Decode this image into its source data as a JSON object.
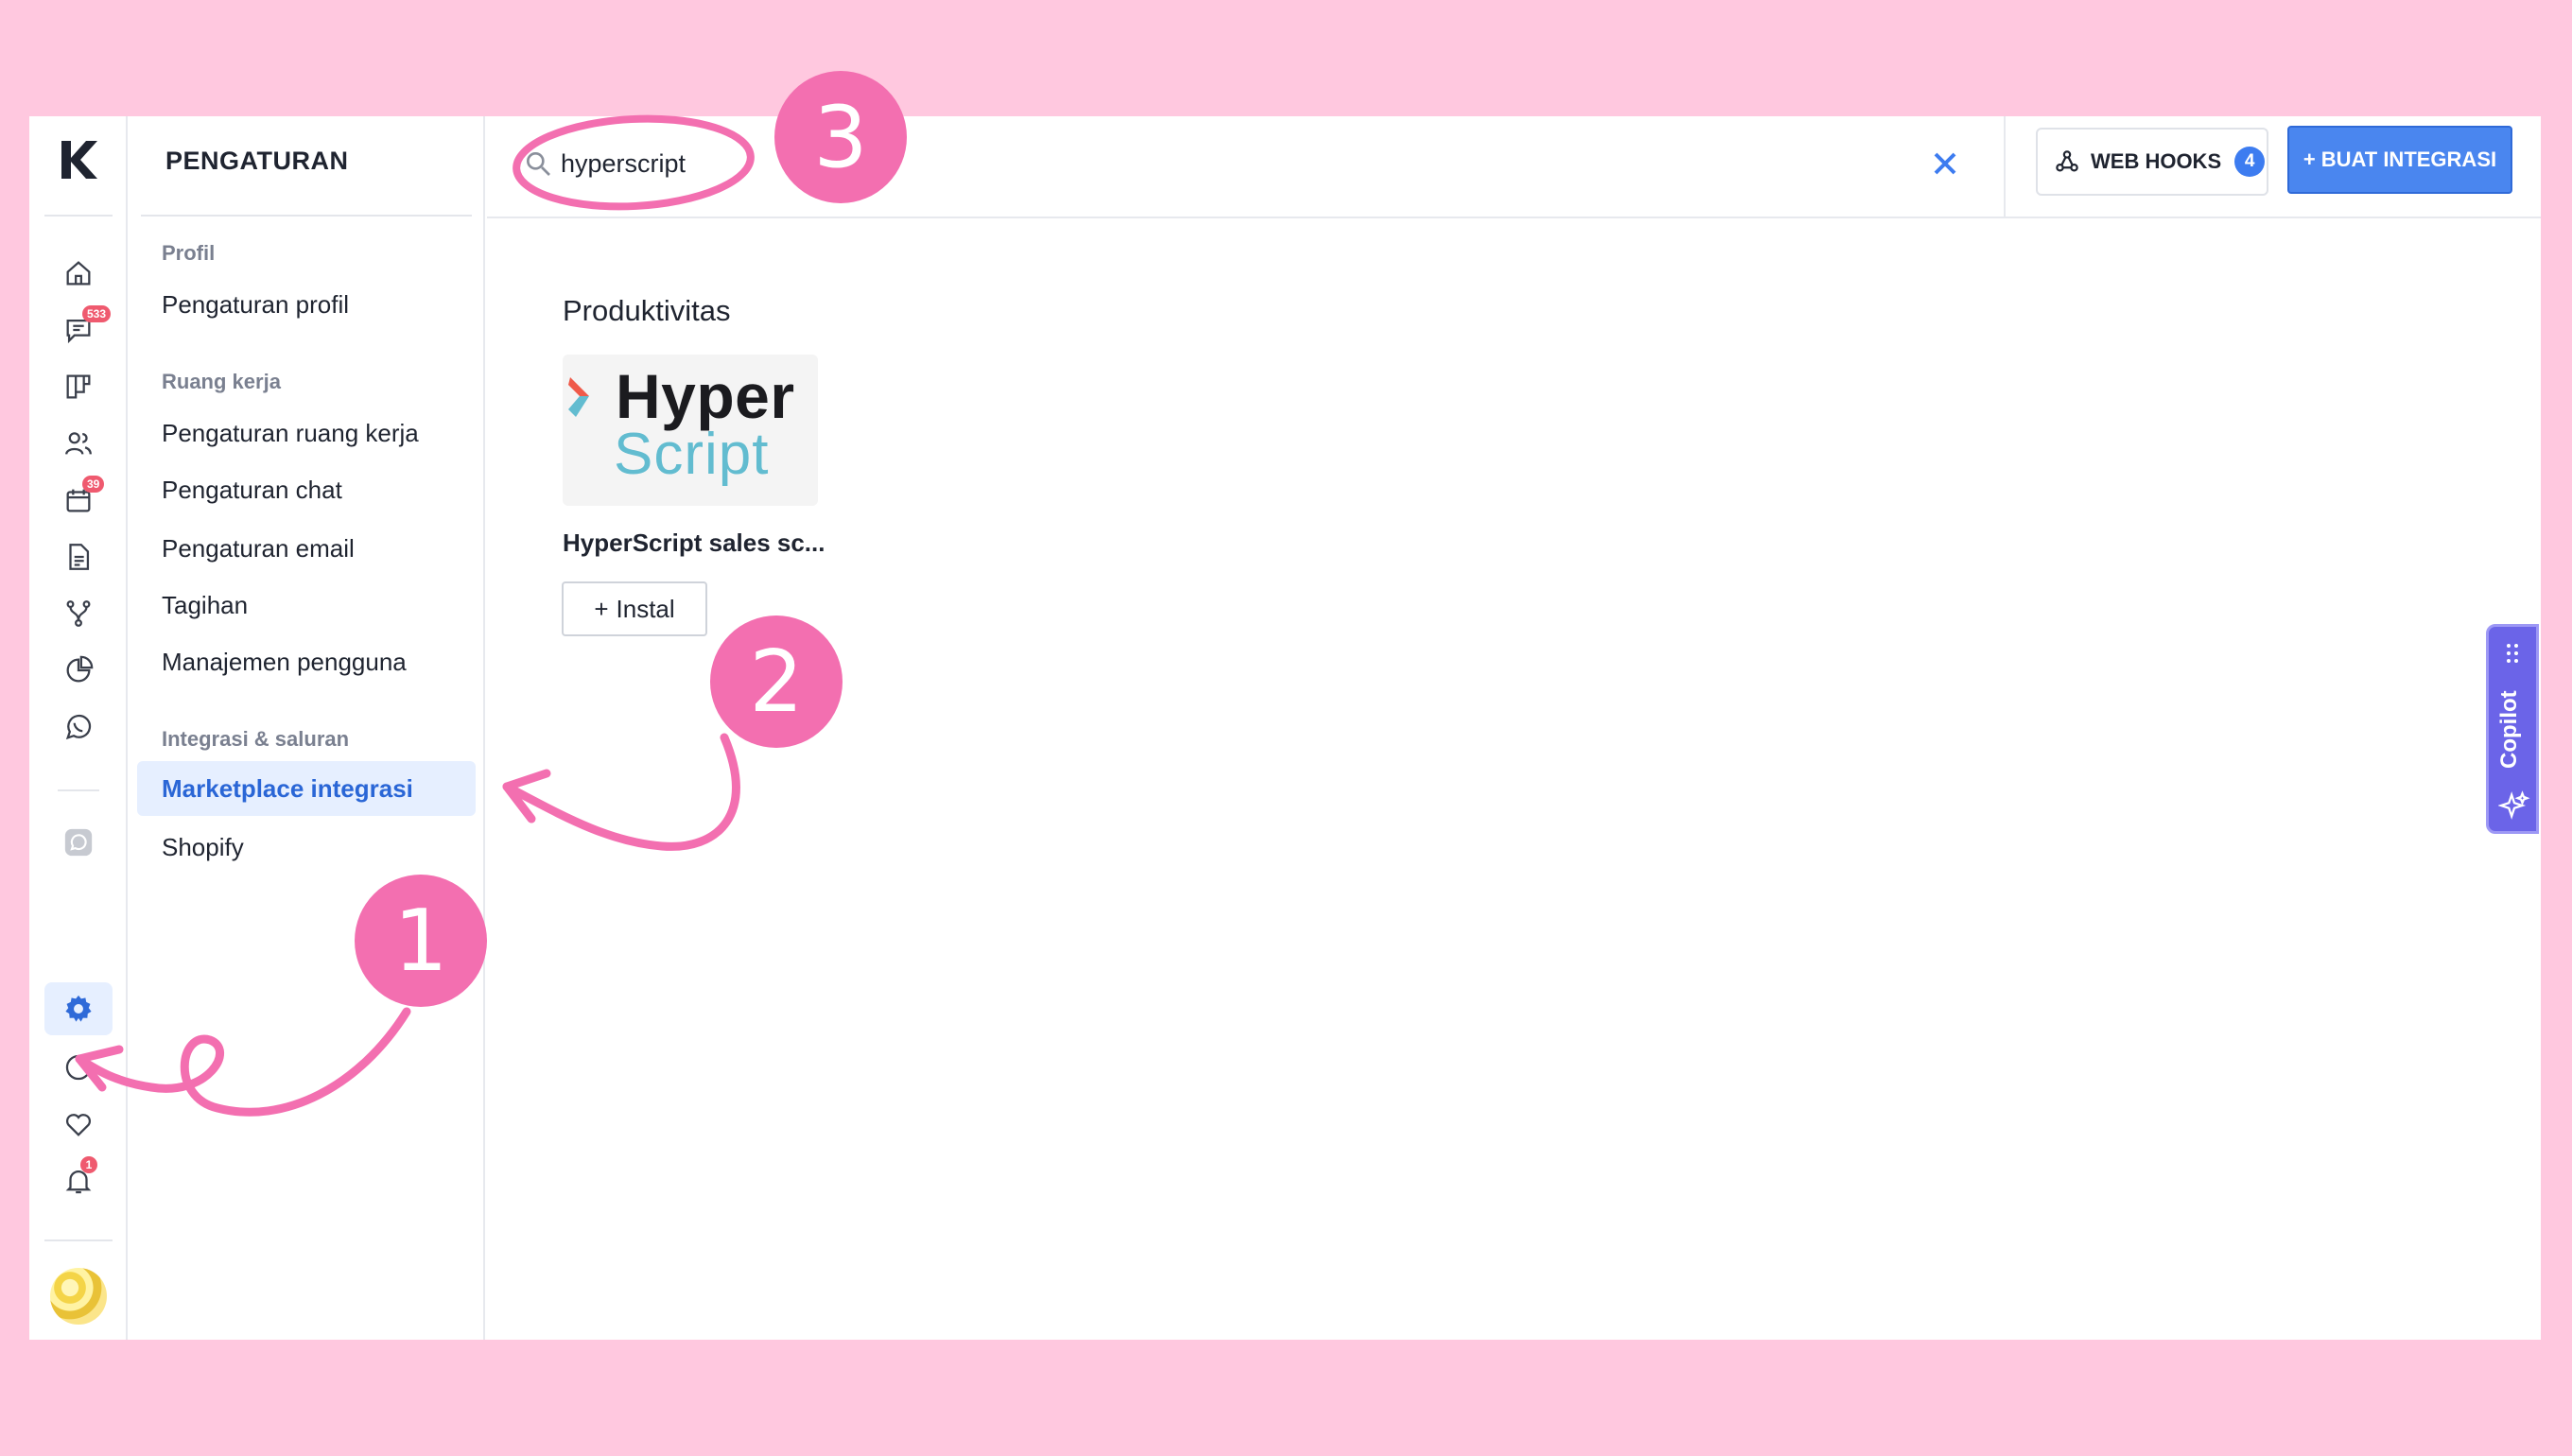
{
  "rail": {
    "badges": {
      "chat": "533",
      "calendar": "39",
      "notifications": "1"
    }
  },
  "settings": {
    "title": "PENGATURAN",
    "sections": [
      {
        "heading": "Profil",
        "items": [
          "Pengaturan profil"
        ]
      },
      {
        "heading": "Ruang kerja",
        "items": [
          "Pengaturan ruang kerja",
          "Pengaturan chat",
          "Pengaturan email",
          "Tagihan",
          "Manajemen pengguna"
        ]
      },
      {
        "heading": "Integrasi & saluran",
        "items": [
          "Marketplace integrasi",
          "Shopify"
        ]
      }
    ],
    "active_item": "Marketplace integrasi"
  },
  "topbar": {
    "search_value": "hyperscript",
    "webhooks_label": "WEB HOOKS",
    "webhooks_count": "4",
    "create_label": "BUAT INTEGRASI",
    "create_prefix": "+"
  },
  "content": {
    "category": "Produktivitas",
    "app": {
      "logo_line1": "Hyper",
      "logo_line2": "Script",
      "name": "HyperScript sales sc...",
      "install_label": "Instal",
      "install_prefix": "+"
    }
  },
  "copilot": {
    "label": "Copilot"
  },
  "annotations": {
    "step1": "1",
    "step2": "2",
    "step3": "3"
  },
  "colors": {
    "accent": "#3d7cf0",
    "annotation": "#f36fb0",
    "background": "#ffc8df",
    "copilot": "#6b64e8"
  }
}
